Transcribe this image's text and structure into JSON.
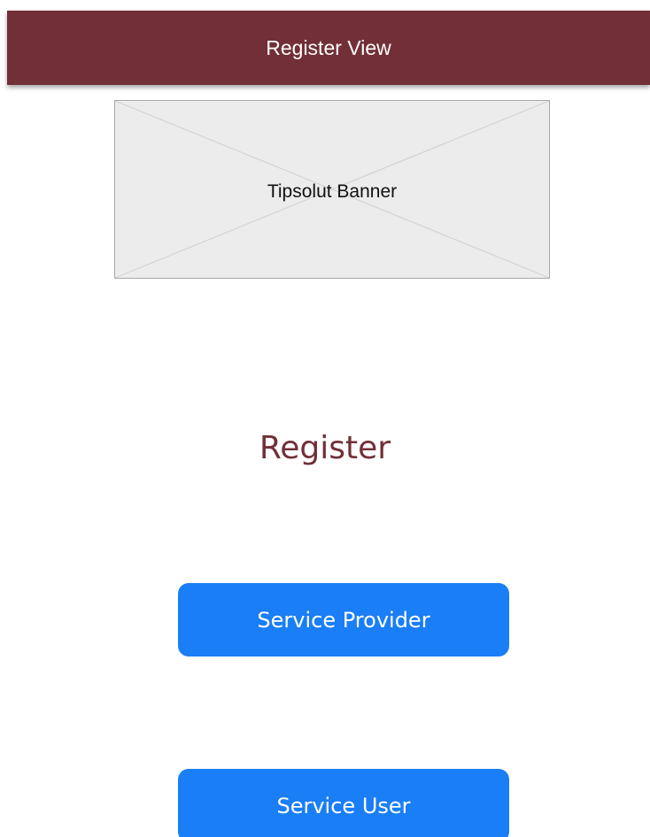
{
  "header": {
    "title": "Register View",
    "background_color": "#722f37",
    "text_color": "#ffffff"
  },
  "banner": {
    "label": "Tipsolut Banner",
    "background_color": "#ececec",
    "icon": "image-placeholder-icon"
  },
  "main": {
    "title": "Register",
    "title_color": "#722f37"
  },
  "buttons": {
    "service_provider_label": "Service Provider",
    "service_user_label": "Service User",
    "button_color": "#1a7ef6",
    "button_text_color": "#ffffff"
  }
}
